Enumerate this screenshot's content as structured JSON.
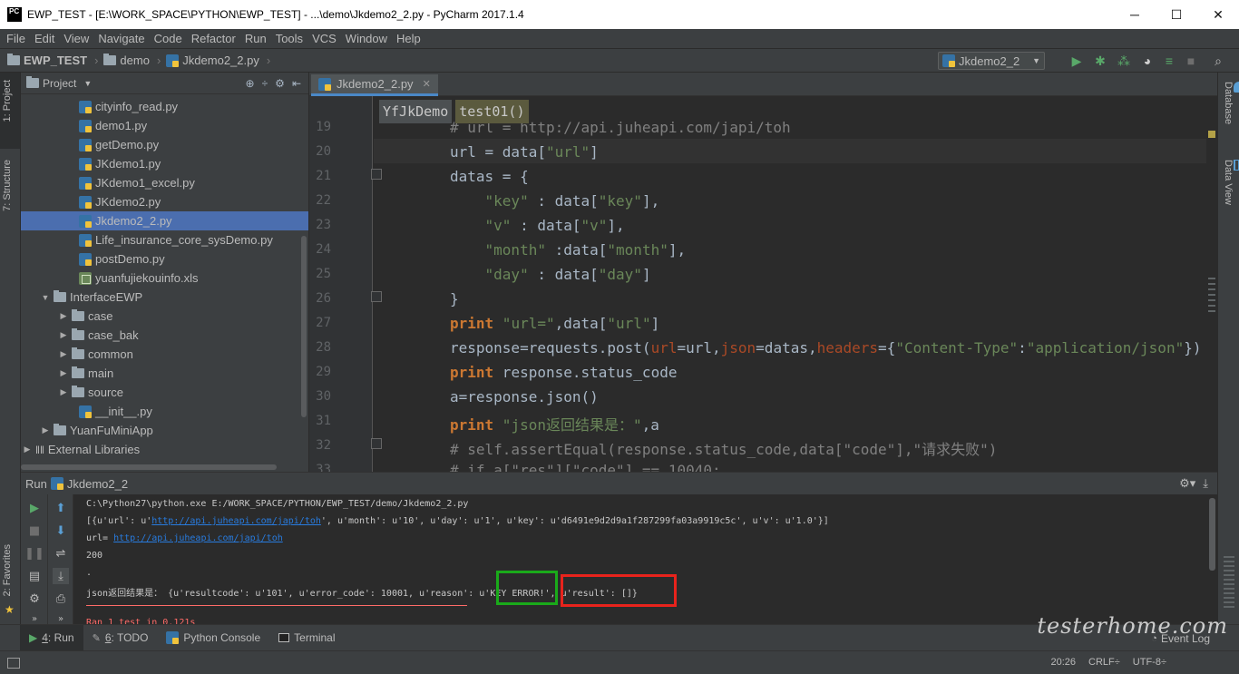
{
  "window": {
    "title": "EWP_TEST - [E:\\WORK_SPACE\\PYTHON\\EWP_TEST] - ...\\demo\\Jkdemo2_2.py - PyCharm 2017.1.4",
    "logo_text": "PC",
    "minimize": "─",
    "maximize": "☐",
    "close": "✕"
  },
  "menu": [
    "File",
    "Edit",
    "View",
    "Navigate",
    "Code",
    "Refactor",
    "Run",
    "Tools",
    "VCS",
    "Window",
    "Help"
  ],
  "navbar": {
    "crumbs": [
      "EWP_TEST",
      "demo",
      "Jkdemo2_2.py"
    ],
    "run_config": "Jkdemo2_2"
  },
  "left_stripe": {
    "project": "1: Project",
    "structure": "7: Structure",
    "favorites": "2: Favorites"
  },
  "right_stripe": {
    "database": "Database",
    "data_view": "Data View"
  },
  "project": {
    "title": "Project",
    "items": [
      {
        "label": "cityinfo_read.py",
        "type": "py"
      },
      {
        "label": "demo1.py",
        "type": "py"
      },
      {
        "label": "getDemo.py",
        "type": "py"
      },
      {
        "label": "JKdemo1.py",
        "type": "py"
      },
      {
        "label": "JKdemo1_excel.py",
        "type": "py"
      },
      {
        "label": "JKdemo2.py",
        "type": "py"
      },
      {
        "label": "Jkdemo2_2.py",
        "type": "py"
      },
      {
        "label": "Life_insurance_core_sysDemo.py",
        "type": "py"
      },
      {
        "label": "postDemo.py",
        "type": "py"
      },
      {
        "label": "yuanfujiekouinfo.xls",
        "type": "xls"
      },
      {
        "label": "InterfaceEWP",
        "type": "folder-open"
      },
      {
        "label": "case",
        "type": "folder"
      },
      {
        "label": "case_bak",
        "type": "folder"
      },
      {
        "label": "common",
        "type": "folder"
      },
      {
        "label": "main",
        "type": "folder"
      },
      {
        "label": "source",
        "type": "folder"
      },
      {
        "label": "__init__.py",
        "type": "py"
      },
      {
        "label": "YuanFuMiniApp",
        "type": "folder"
      },
      {
        "label": "External Libraries",
        "type": "lib"
      }
    ]
  },
  "editor": {
    "tab": "Jkdemo2_2.py",
    "chips": [
      "YfJkDemo",
      "test01()"
    ],
    "line_numbers": [
      "19",
      "20",
      "21",
      "22",
      "23",
      "24",
      "25",
      "26",
      "27",
      "28",
      "29",
      "30",
      "31",
      "32",
      "33"
    ],
    "lines": {
      "l19": "# url = http://api.juheapi.com/japi/toh",
      "l20a": "url = data[",
      "l20b": "\"url\"",
      "l20c": "]",
      "l21": "datas = {",
      "l22a": "    ",
      "l22b": "\"key\"",
      "l22c": " : data[",
      "l22d": "\"key\"",
      "l22e": "],",
      "l23a": "    ",
      "l23b": "\"v\"",
      "l23c": " : data[",
      "l23d": "\"v\"",
      "l23e": "],",
      "l24a": "    ",
      "l24b": "\"month\"",
      "l24c": " :data[",
      "l24d": "\"month\"",
      "l24e": "],",
      "l25a": "    ",
      "l25b": "\"day\"",
      "l25c": " : data[",
      "l25d": "\"day\"",
      "l25e": "]",
      "l26": "}",
      "l27a": "print",
      "l27b": " \"url=\"",
      "l27c": ",data[",
      "l27d": "\"url\"",
      "l27e": "]",
      "l28a": "response=requests.post(",
      "l28b": "url",
      "l28c": "=url,",
      "l28d": "json",
      "l28e": "=datas,",
      "l28f": "headers",
      "l28g": "={",
      "l28h": "\"Content-Type\"",
      "l28i": ":",
      "l28j": "\"application/json\"",
      "l28k": "})",
      "l29a": "print",
      "l29b": " response.status_code",
      "l30": "a=response.json()",
      "l31a": "print",
      "l31b": " \"json返回结果是：\"",
      "l31c": ",a",
      "l32": "# self.assertEqual(response.status_code,data[\"code\"],\"请求失败\")",
      "l33": "# if a[\"res\"][\"code\"] == 10040:"
    }
  },
  "run": {
    "title": "Run",
    "config": "Jkdemo2_2",
    "lines": {
      "cmd": "C:\\Python27\\python.exe E:/WORK_SPACE/PYTHON/EWP_TEST/demo/Jkdemo2_2.py",
      "data_a": "[{u'url': u'",
      "data_link": "http://api.juheapi.com/japi/toh",
      "data_b": "', u'month': u'10', u'day': u'1', u'key': u'd6491e9d2d9a1f287299fa03a9919c5c', u'v': u'1.0'}]",
      "url_a": "url= ",
      "url_link": "http://api.juheapi.com/japi/toh",
      "code": "200",
      "dot": ".",
      "result_a": "json返回结果是： {u'resultcode': u'101', u'error_code': 10001, u'reason': u'",
      "result_b": "KEY ERROR!",
      "result_c": "', ",
      "result_d": "u'result': []}",
      "ran": "Ran 1 test in 0.121s"
    }
  },
  "bottom_tabs": [
    {
      "num": "4",
      "label": ": Run"
    },
    {
      "num": "6",
      "label": ": TODO"
    },
    {
      "num": "",
      "label": "Python Console"
    },
    {
      "num": "",
      "label": "Terminal"
    }
  ],
  "event_log": "Event Log",
  "status": {
    "position": "20:26",
    "line_sep": "CRLF÷",
    "encoding": "UTF-8÷"
  },
  "watermark": "testerhome.com",
  "colors": {
    "accent": "#4b6eaf",
    "green_box": "#1aaa1a",
    "red_box": "#e8231c"
  }
}
